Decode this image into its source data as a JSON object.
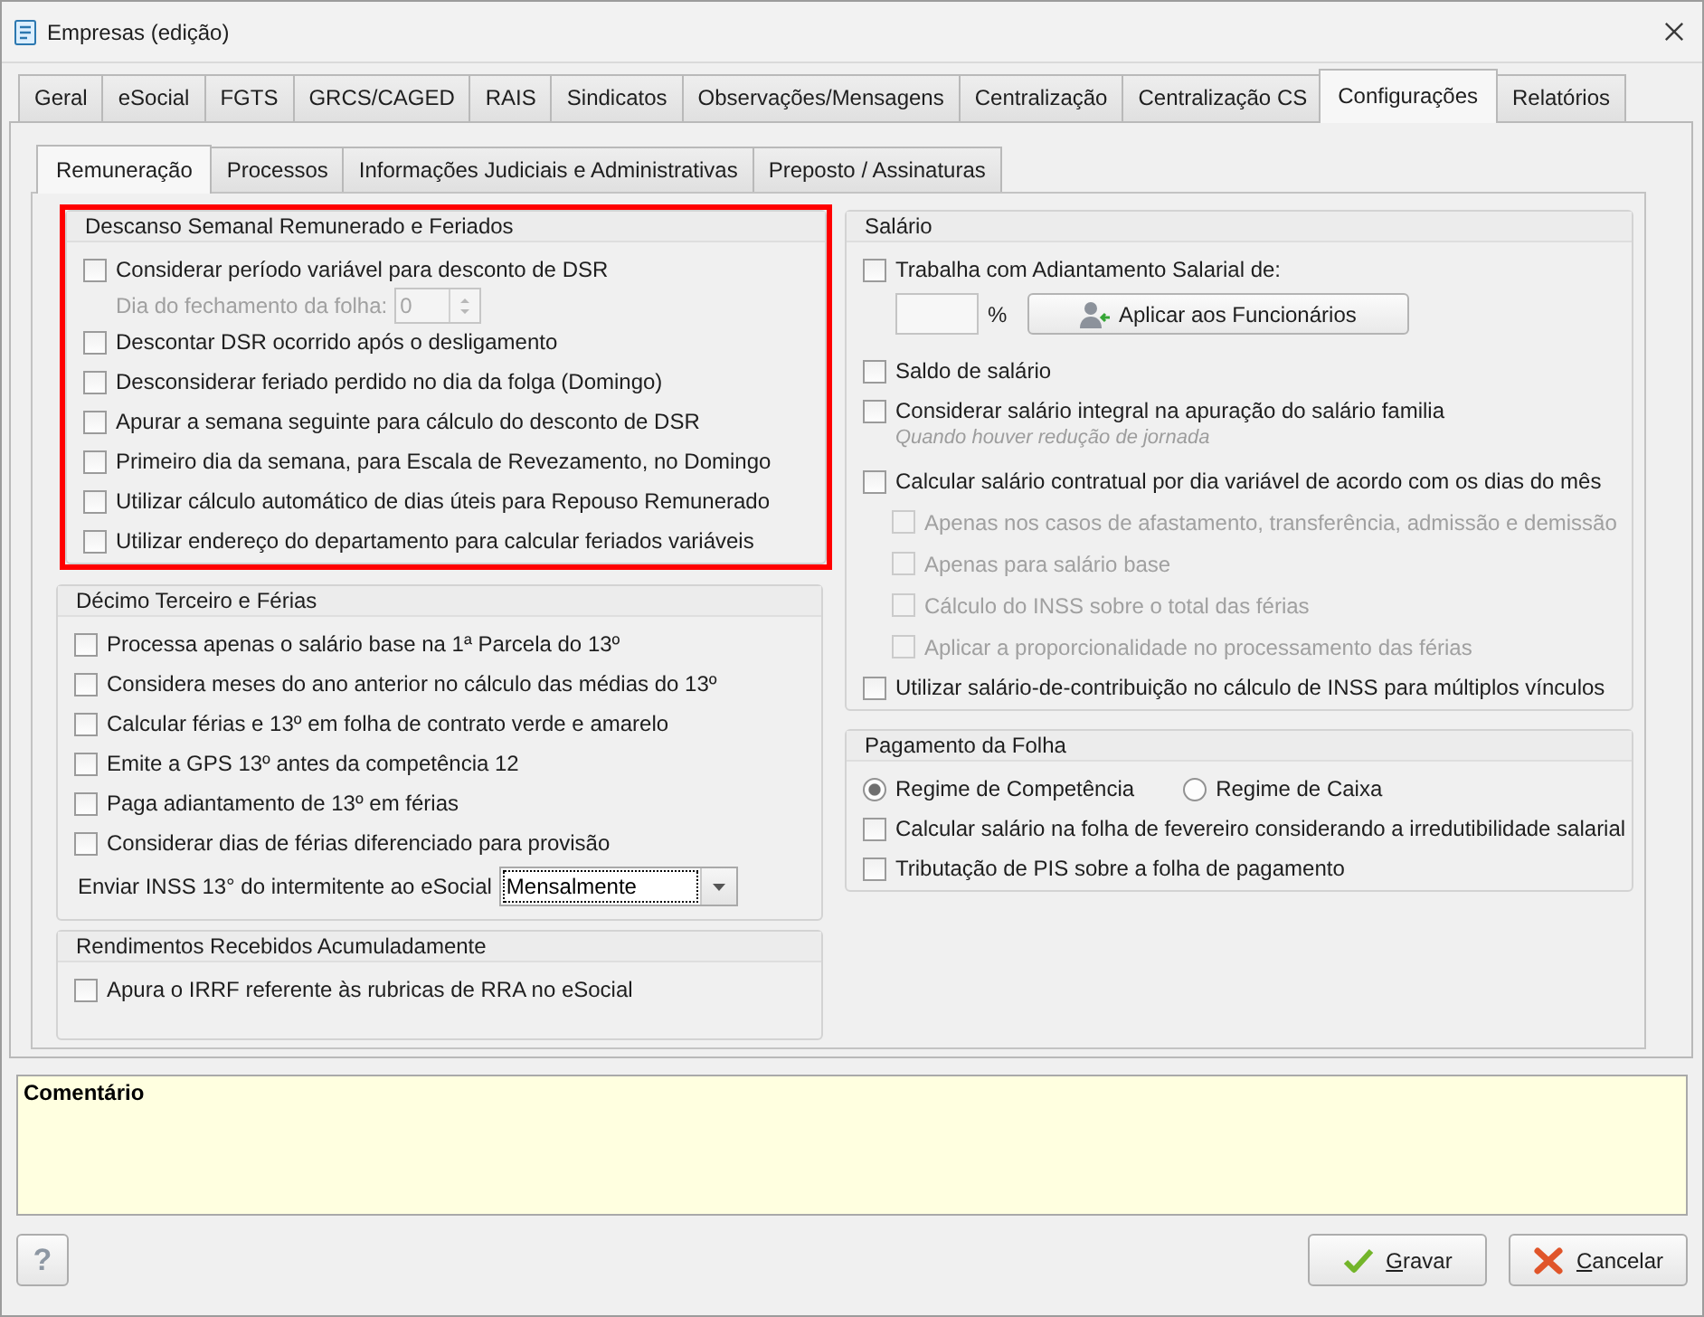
{
  "window": {
    "title": "Empresas (edição)"
  },
  "tabs": [
    {
      "label": "Geral",
      "selected": false
    },
    {
      "label": "eSocial",
      "selected": false
    },
    {
      "label": "FGTS",
      "selected": false
    },
    {
      "label": "GRCS/CAGED",
      "selected": false
    },
    {
      "label": "RAIS",
      "selected": false
    },
    {
      "label": "Sindicatos",
      "selected": false
    },
    {
      "label": "Observações/Mensagens",
      "selected": false
    },
    {
      "label": "Centralização",
      "selected": false
    },
    {
      "label": "Centralização CS",
      "selected": false
    },
    {
      "label": "Configurações",
      "selected": true
    },
    {
      "label": "Relatórios",
      "selected": false
    }
  ],
  "subtabs": [
    {
      "label": "Remuneração",
      "selected": true
    },
    {
      "label": "Processos",
      "selected": false
    },
    {
      "label": "Informações Judiciais e Administrativas",
      "selected": false
    },
    {
      "label": "Preposto / Assinaturas",
      "selected": false
    }
  ],
  "left_groups": [
    {
      "title": "Descanso Semanal Remunerado e Feriados",
      "highlighted": true,
      "items": [
        {
          "kind": "checkbox",
          "label": "Considerar período variável para desconto de DSR",
          "checked": false,
          "disabled": false
        },
        {
          "kind": "spin",
          "label": "Dia do fechamento da folha:",
          "value": "0",
          "disabled": true
        },
        {
          "kind": "checkbox",
          "label": "Descontar DSR ocorrido após o desligamento",
          "checked": false,
          "disabled": false
        },
        {
          "kind": "checkbox",
          "label": "Desconsiderar feriado perdido no dia da folga (Domingo)",
          "checked": false,
          "disabled": false
        },
        {
          "kind": "checkbox",
          "label": "Apurar a semana seguinte para cálculo do desconto de DSR",
          "checked": false,
          "disabled": false
        },
        {
          "kind": "checkbox",
          "label": "Primeiro dia da semana, para Escala de Revezamento, no Domingo",
          "checked": false,
          "disabled": false
        },
        {
          "kind": "checkbox",
          "label": "Utilizar cálculo automático de dias úteis para Repouso Remunerado",
          "checked": false,
          "disabled": false
        },
        {
          "kind": "checkbox",
          "label": "Utilizar endereço do departamento para calcular feriados variáveis",
          "checked": false,
          "disabled": false
        }
      ]
    },
    {
      "title": "Décimo Terceiro e Férias",
      "highlighted": false,
      "items": [
        {
          "kind": "checkbox",
          "label": "Processa apenas o salário base na 1ª Parcela do 13º",
          "checked": false,
          "disabled": false
        },
        {
          "kind": "checkbox",
          "label": "Considera meses do ano anterior no cálculo das médias do 13º",
          "checked": false,
          "disabled": false
        },
        {
          "kind": "checkbox",
          "label": "Calcular férias e 13º em folha de contrato verde e amarelo",
          "checked": false,
          "disabled": false
        },
        {
          "kind": "checkbox",
          "label": "Emite a GPS 13º antes da competência 12",
          "checked": false,
          "disabled": false
        },
        {
          "kind": "checkbox",
          "label": "Paga adiantamento de 13º em férias",
          "checked": false,
          "disabled": false
        },
        {
          "kind": "checkbox",
          "label": "Considerar dias de férias diferenciado para provisão",
          "checked": false,
          "disabled": false
        },
        {
          "kind": "combo",
          "label": "Enviar INSS 13° do intermitente ao eSocial",
          "value": "Mensalmente",
          "focused": true
        }
      ]
    },
    {
      "title": "Rendimentos Recebidos Acumuladamente",
      "highlighted": false,
      "items": [
        {
          "kind": "checkbox",
          "label": "Apura o IRRF referente às rubricas de RRA no eSocial",
          "checked": false,
          "disabled": false
        }
      ]
    }
  ],
  "right_groups": [
    {
      "title": "Salário",
      "highlighted": false,
      "items": [
        {
          "kind": "checkbox",
          "label": "Trabalha com Adiantamento Salarial de:",
          "checked": false,
          "disabled": false
        },
        {
          "kind": "percent",
          "unit": "%",
          "button": "Aplicar aos Funcionários"
        },
        {
          "kind": "checkbox",
          "label": "Saldo de salário",
          "checked": false,
          "disabled": false
        },
        {
          "kind": "checkbox",
          "label": "Considerar salário integral na apuração do salário familia",
          "hint": "Quando houver redução de jornada",
          "checked": false,
          "disabled": false
        },
        {
          "kind": "checkbox",
          "label": "Calcular salário contratual por dia variável de acordo com os dias do mês",
          "checked": false,
          "disabled": false,
          "children": [
            {
              "label": "Apenas nos casos de afastamento, transferência, admissão e demissão",
              "checked": false,
              "disabled": true
            },
            {
              "label": "Apenas para salário base",
              "checked": false,
              "disabled": true
            },
            {
              "label": "Cálculo do INSS sobre o total das férias",
              "checked": false,
              "disabled": true
            },
            {
              "label": "Aplicar a proporcionalidade no processamento das férias",
              "checked": false,
              "disabled": true
            }
          ]
        },
        {
          "kind": "checkbox",
          "label": "Utilizar salário-de-contribuição no cálculo de INSS para múltiplos vínculos",
          "checked": false,
          "disabled": false
        }
      ]
    },
    {
      "title": "Pagamento da Folha",
      "highlighted": false,
      "items": [
        {
          "kind": "radio",
          "options": [
            {
              "label": "Regime de Competência",
              "selected": true
            },
            {
              "label": "Regime de Caixa",
              "selected": false
            }
          ]
        },
        {
          "kind": "checkbox",
          "label": "Calcular salário na folha de fevereiro considerando a irredutibilidade salarial",
          "checked": false,
          "disabled": false
        },
        {
          "kind": "checkbox",
          "label": "Tributação de PIS sobre a folha de pagamento",
          "checked": false,
          "disabled": false
        }
      ]
    }
  ],
  "comment": {
    "label": "Comentário"
  },
  "help_button": {
    "label": "?"
  },
  "buttons": [
    {
      "kind": "save",
      "label": "Gravar",
      "underline_first": true
    },
    {
      "kind": "cancel",
      "label": "Cancelar",
      "underline_first": true
    }
  ]
}
